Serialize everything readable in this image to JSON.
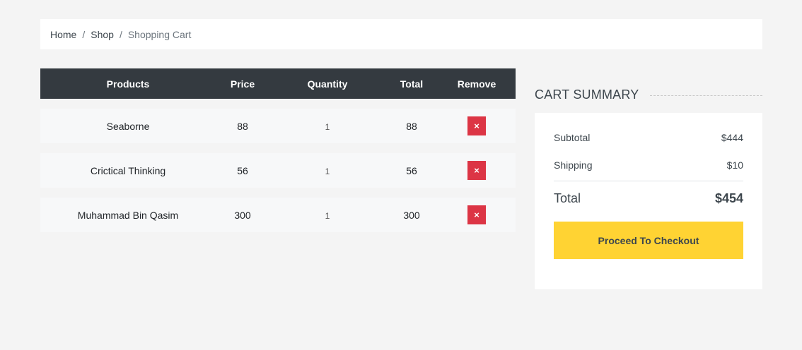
{
  "breadcrumb": {
    "items": [
      "Home",
      "Shop"
    ],
    "separator": "/",
    "active": "Shopping Cart"
  },
  "cart": {
    "headers": {
      "products": "Products",
      "price": "Price",
      "quantity": "Quantity",
      "total": "Total",
      "remove": "Remove"
    },
    "rows": [
      {
        "product": "Seaborne",
        "price": "88",
        "quantity": "1",
        "total": "88",
        "remove_icon": "×"
      },
      {
        "product": "Crictical Thinking",
        "price": "56",
        "quantity": "1",
        "total": "56",
        "remove_icon": "×"
      },
      {
        "product": "Muhammad Bin Qasim",
        "price": "300",
        "quantity": "1",
        "total": "300",
        "remove_icon": "×"
      }
    ]
  },
  "summary": {
    "title": "CART SUMMARY",
    "subtotal_label": "Subtotal",
    "subtotal_value": "$444",
    "shipping_label": "Shipping",
    "shipping_value": "$10",
    "total_label": "Total",
    "total_value": "$454",
    "checkout_label": "Proceed To Checkout"
  },
  "colors": {
    "accent": "#ffd333",
    "header_bg": "#343a40",
    "remove_bg": "#dc3545"
  }
}
